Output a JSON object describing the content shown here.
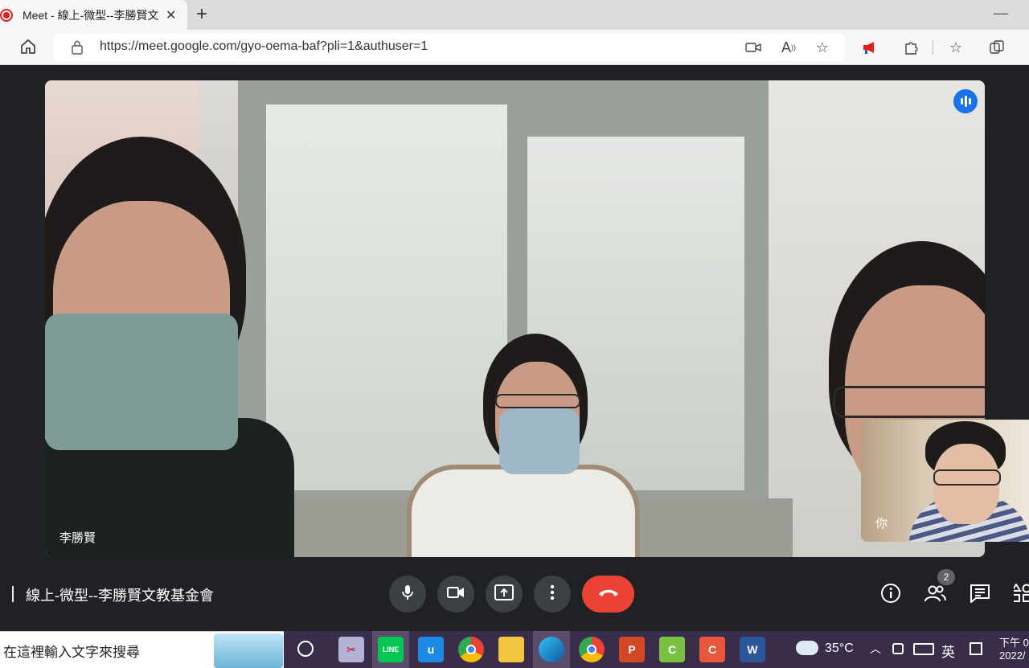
{
  "browser": {
    "tab_title": "Meet - 線上-微型--李勝賢文",
    "new_tab_symbol": "+",
    "close_symbol": "✕",
    "minimize_symbol": "—",
    "url": "https://meet.google.com/gyo-oema-baf?pli=1&authuser=1"
  },
  "meet": {
    "main_participant_name": "李勝賢",
    "self_name": "你",
    "meeting_title": "線上-微型--李勝賢文教基金會",
    "participant_count": "2"
  },
  "taskbar": {
    "search_placeholder": "在這裡輸入文字來搜尋",
    "temperature": "35°C",
    "ime": "英",
    "clock_line1": "下午 0",
    "clock_line2": "2022/"
  },
  "colors": {
    "meet_background": "#202124",
    "hangup_red": "#ea4335",
    "speaking_blue": "#1a73e8",
    "recording_red": "#e0201b"
  },
  "icons": [
    "recording-icon",
    "home-icon",
    "lock-icon",
    "camera-icon",
    "read-aloud-icon",
    "favorite-add-icon",
    "megaphone-icon",
    "extensions-icon",
    "favorites-icon",
    "collections-icon",
    "microphone-icon",
    "video-camera-icon",
    "present-icon",
    "more-options-icon",
    "hangup-icon",
    "info-icon",
    "people-icon",
    "chat-icon",
    "activities-icon",
    "cortana-icon",
    "weather-icon",
    "keyboard-icon"
  ]
}
